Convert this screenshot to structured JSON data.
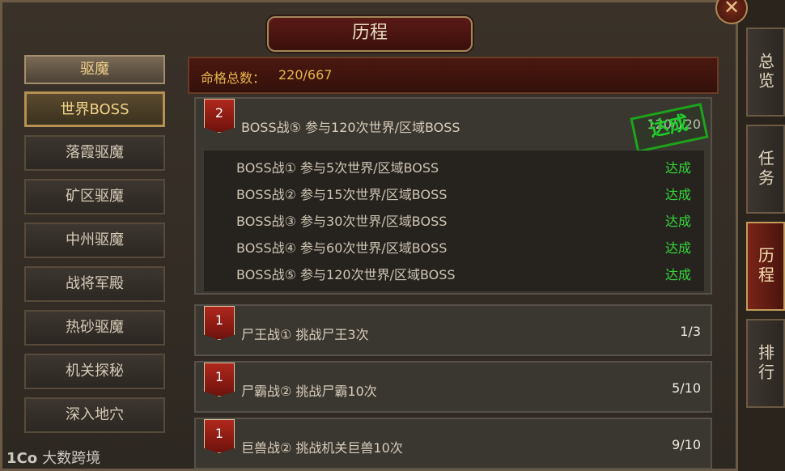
{
  "window": {
    "title": "历程",
    "close_glyph": "✕"
  },
  "left_menu": {
    "items": [
      {
        "label": "驱魔",
        "state": "header"
      },
      {
        "label": "世界BOSS",
        "state": "active"
      },
      {
        "label": "落霞驱魔",
        "state": "normal"
      },
      {
        "label": "矿区驱魔",
        "state": "normal"
      },
      {
        "label": "中州驱魔",
        "state": "normal"
      },
      {
        "label": "战将军殿",
        "state": "normal"
      },
      {
        "label": "热砂驱魔",
        "state": "normal"
      },
      {
        "label": "机关探秘",
        "state": "normal"
      },
      {
        "label": "深入地穴",
        "state": "normal"
      }
    ]
  },
  "summary": {
    "label": "命格总数：",
    "value": "220/667"
  },
  "cards": [
    {
      "badge": "2",
      "title": "BOSS战⑤ 参与120次世界/区域BOSS",
      "progress": "120/120",
      "stamp": "达成",
      "sub_items": [
        {
          "text": "BOSS战① 参与5次世界/区域BOSS",
          "status": "达成"
        },
        {
          "text": "BOSS战② 参与15次世界/区域BOSS",
          "status": "达成"
        },
        {
          "text": "BOSS战③ 参与30次世界/区域BOSS",
          "status": "达成"
        },
        {
          "text": "BOSS战④ 参与60次世界/区域BOSS",
          "status": "达成"
        },
        {
          "text": "BOSS战⑤ 参与120次世界/区域BOSS",
          "status": "达成"
        }
      ]
    },
    {
      "badge": "1",
      "title": "尸王战① 挑战尸王3次",
      "progress": "1/3"
    },
    {
      "badge": "1",
      "title": "尸霸战② 挑战尸霸10次",
      "progress": "5/10"
    },
    {
      "badge": "1",
      "title": "巨兽战② 挑战机关巨兽10次",
      "progress": "9/10"
    }
  ],
  "right_tabs": [
    {
      "label": "总览",
      "state": "normal"
    },
    {
      "label": "任务",
      "state": "normal"
    },
    {
      "label": "历程",
      "state": "active"
    },
    {
      "label": "排行",
      "state": "normal"
    }
  ],
  "watermark": {
    "logo": "1Co",
    "text": "大数跨境"
  },
  "colors": {
    "accent_gold": "#e7b64c",
    "complete_green": "#36d63a",
    "badge_red": "#b0281d"
  }
}
